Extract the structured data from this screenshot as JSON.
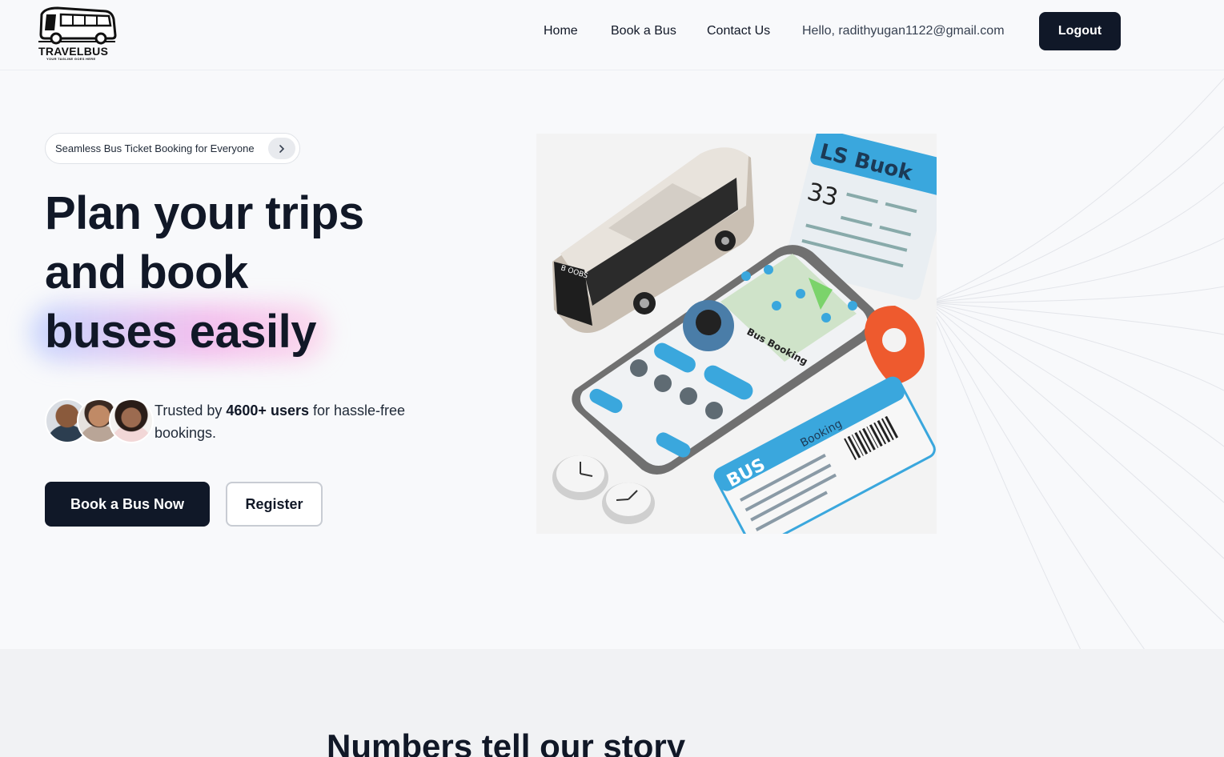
{
  "brand": {
    "name": "TRAVELBUS",
    "tagline": "YOUR TAGLINE GOES HERE"
  },
  "nav": {
    "home": "Home",
    "book": "Book a Bus",
    "contact": "Contact Us",
    "greeting": "Hello, radithyugan1122@gmail.com",
    "logout": "Logout"
  },
  "hero": {
    "pill": "Seamless Bus Ticket Booking for Everyone",
    "title_line1": "Plan your trips",
    "title_line2": "and book",
    "title_line3": "buses easily",
    "trust_prefix": "Trusted by",
    "trust_count": "4600+ users",
    "trust_suffix": "for hassle-free bookings.",
    "primary_button": "Book a Bus Now",
    "secondary_button": "Register"
  },
  "illustration": {
    "ticket_card_title": "LS Buok",
    "ticket_card_number": "33",
    "phone_header": "Bus Booking",
    "ticket_title": "BUS",
    "ticket_subtitle": "Booking",
    "bus_sign": "B OOBS"
  },
  "stats": {
    "title": "Numbers tell our story"
  },
  "colors": {
    "primary": "#101828",
    "accent_blue": "#3aa7dd",
    "pin": "#ee5a2e"
  }
}
